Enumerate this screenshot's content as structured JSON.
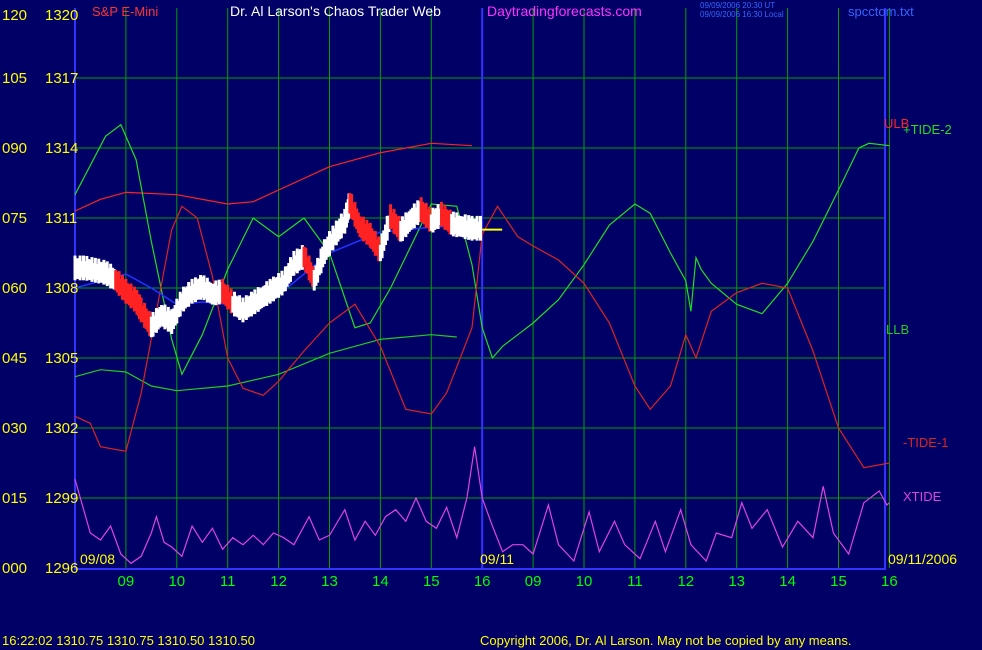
{
  "header": {
    "symbol_label": "S&P E-Mini",
    "title": "Dr. Al Larson's Chaos Trader Web",
    "site": "Daytradingforecasts.com",
    "stamp_line1": "09/09/2006 20:30 UT",
    "stamp_line2": "09/09/2006 16:30 Local",
    "file_name": "spcctom.txt"
  },
  "footer": {
    "quote": "16:22:02  1310.75 1310.75 1310.50 1310.50",
    "copyright": "Copyright 2006, Dr. Al Larson. May not be copied by any means."
  },
  "chart_data": {
    "type": "line",
    "y_labels_left": [
      "120",
      "105",
      "090",
      "075",
      "060",
      "045",
      "030",
      "015",
      "000"
    ],
    "y_labels_price": [
      "1320",
      "1317",
      "1314",
      "1311",
      "1308",
      "1305",
      "1302",
      "1299",
      "1296"
    ],
    "ylim_tide": [
      0,
      120
    ],
    "ylim_price": [
      1296,
      1320
    ],
    "x_ticks": [
      "09",
      "10",
      "11",
      "12",
      "13",
      "14",
      "15",
      "16",
      "09",
      "10",
      "11",
      "12",
      "13",
      "14",
      "15",
      "16"
    ],
    "date_labels": {
      "start": "09/08",
      "mid": "09/11",
      "end": "09/11/2006"
    },
    "grid": true,
    "series_labels": {
      "ulb": "ULB",
      "tide2": "+TIDE-2",
      "llb": "LLB",
      "tide1": "-TIDE-1",
      "xtide": "XTIDE"
    },
    "colors": {
      "background": "#000066",
      "grid": "#00a000",
      "axis": "#3333ff",
      "tick_text": "#00ff00",
      "left_text": "#ffff00",
      "ulb": "#ff2222",
      "tide2": "#22dd22",
      "llb": "#22cc22",
      "tide1": "#dd2222",
      "xtide": "#dd44dd",
      "price": "#ffffff",
      "price_down": "#ff2222",
      "avg": "#2233ff",
      "fast": "#ffff00"
    },
    "series": {
      "ulb": [
        [
          0,
          1311.3
        ],
        [
          0.5,
          1311.8
        ],
        [
          1,
          1312.1
        ],
        [
          2,
          1312.0
        ],
        [
          3,
          1311.6
        ],
        [
          3.5,
          1311.7
        ],
        [
          4,
          1312.2
        ],
        [
          5,
          1313.2
        ],
        [
          6,
          1313.8
        ],
        [
          7,
          1314.2
        ],
        [
          7.8,
          1314.1
        ]
      ],
      "llb": [
        [
          0,
          1304.2
        ],
        [
          0.5,
          1304.5
        ],
        [
          1,
          1304.4
        ],
        [
          1.5,
          1303.8
        ],
        [
          2,
          1303.6
        ],
        [
          3,
          1303.8
        ],
        [
          4,
          1304.3
        ],
        [
          5,
          1305.2
        ],
        [
          6,
          1305.8
        ],
        [
          7,
          1306.0
        ],
        [
          7.5,
          1305.9
        ]
      ],
      "tide2": [
        [
          0,
          1312.0
        ],
        [
          0.6,
          1314.5
        ],
        [
          0.9,
          1315.0
        ],
        [
          1.2,
          1313.5
        ],
        [
          1.5,
          1310.0
        ],
        [
          1.9,
          1305.8
        ],
        [
          2.1,
          1304.3
        ],
        [
          2.5,
          1306.0
        ],
        [
          3,
          1308.8
        ],
        [
          3.5,
          1311.0
        ],
        [
          4,
          1310.2
        ],
        [
          4.5,
          1311.0
        ],
        [
          5,
          1309.5
        ],
        [
          5.5,
          1306.3
        ],
        [
          5.8,
          1306.5
        ],
        [
          6.2,
          1308.0
        ],
        [
          7,
          1311.6
        ],
        [
          7.5,
          1311.5
        ],
        [
          7.8,
          1309.0
        ],
        [
          8,
          1306.3
        ],
        [
          8.2,
          1305.0
        ],
        [
          8.4,
          1305.5
        ],
        [
          8.7,
          1306.0
        ],
        [
          9,
          1306.5
        ],
        [
          9.5,
          1307.5
        ],
        [
          10,
          1309.0
        ],
        [
          10.5,
          1310.7
        ],
        [
          11,
          1311.6
        ],
        [
          11.3,
          1311.2
        ],
        [
          11.7,
          1309.5
        ],
        [
          12,
          1308.3
        ],
        [
          12.1,
          1307.0
        ],
        [
          12.2,
          1309.3
        ],
        [
          12.3,
          1308.8
        ],
        [
          12.5,
          1308.2
        ],
        [
          13,
          1307.3
        ],
        [
          13.5,
          1306.9
        ],
        [
          14,
          1308.2
        ],
        [
          14.5,
          1310.0
        ],
        [
          15,
          1312.2
        ],
        [
          15.4,
          1314.0
        ],
        [
          15.6,
          1314.2
        ],
        [
          16,
          1314.1
        ]
      ],
      "tide1": [
        [
          0,
          1302.5
        ],
        [
          0.3,
          1302.2
        ],
        [
          0.5,
          1301.2
        ],
        [
          1,
          1301.0
        ],
        [
          1.3,
          1303.5
        ],
        [
          1.6,
          1307.0
        ],
        [
          1.9,
          1310.5
        ],
        [
          2.1,
          1311.5
        ],
        [
          2.4,
          1311.0
        ],
        [
          2.7,
          1308.5
        ],
        [
          3,
          1305.0
        ],
        [
          3.3,
          1303.7
        ],
        [
          3.7,
          1303.4
        ],
        [
          4,
          1304.0
        ],
        [
          4.5,
          1305.3
        ],
        [
          5,
          1306.5
        ],
        [
          5.5,
          1307.3
        ],
        [
          6,
          1305.5
        ],
        [
          6.5,
          1302.8
        ],
        [
          7,
          1302.6
        ],
        [
          7.3,
          1303.5
        ],
        [
          7.8,
          1306.3
        ],
        [
          8,
          1310.3
        ],
        [
          8.3,
          1311.5
        ],
        [
          8.7,
          1310.2
        ],
        [
          9,
          1309.8
        ],
        [
          9.5,
          1309.2
        ],
        [
          10,
          1308.2
        ],
        [
          10.5,
          1306.5
        ],
        [
          11,
          1303.8
        ],
        [
          11.3,
          1302.8
        ],
        [
          11.7,
          1303.8
        ],
        [
          12,
          1306.0
        ],
        [
          12.2,
          1305.0
        ],
        [
          12.5,
          1307.0
        ],
        [
          13,
          1307.8
        ],
        [
          13.5,
          1308.2
        ],
        [
          14,
          1308.0
        ],
        [
          14.5,
          1305.3
        ],
        [
          15,
          1302.0
        ],
        [
          15.5,
          1300.3
        ],
        [
          16,
          1300.5
        ]
      ],
      "xtide": [
        [
          0,
          1299.8
        ],
        [
          0.3,
          1297.5
        ],
        [
          0.5,
          1297.2
        ],
        [
          0.7,
          1297.8
        ],
        [
          0.9,
          1296.6
        ],
        [
          1.1,
          1296.2
        ],
        [
          1.3,
          1296.5
        ],
        [
          1.5,
          1297.5
        ],
        [
          1.6,
          1298.2
        ],
        [
          1.75,
          1297.1
        ],
        [
          1.9,
          1296.9
        ],
        [
          2.1,
          1296.5
        ],
        [
          2.3,
          1297.8
        ],
        [
          2.5,
          1297.1
        ],
        [
          2.7,
          1297.7
        ],
        [
          2.9,
          1296.8
        ],
        [
          3.1,
          1297.3
        ],
        [
          3.3,
          1297.0
        ],
        [
          3.5,
          1297.4
        ],
        [
          3.7,
          1297.0
        ],
        [
          3.9,
          1297.5
        ],
        [
          4.1,
          1297.3
        ],
        [
          4.3,
          1297.0
        ],
        [
          4.6,
          1298.2
        ],
        [
          4.8,
          1297.2
        ],
        [
          5.0,
          1297.4
        ],
        [
          5.3,
          1298.5
        ],
        [
          5.5,
          1297.2
        ],
        [
          5.7,
          1298.0
        ],
        [
          5.9,
          1297.4
        ],
        [
          6.1,
          1298.2
        ],
        [
          6.3,
          1298.5
        ],
        [
          6.5,
          1298.0
        ],
        [
          6.7,
          1299.0
        ],
        [
          6.9,
          1298.0
        ],
        [
          7.1,
          1297.7
        ],
        [
          7.3,
          1298.6
        ],
        [
          7.5,
          1297.3
        ],
        [
          7.7,
          1299.0
        ],
        [
          7.85,
          1301.2
        ],
        [
          8.0,
          1299.0
        ],
        [
          8.2,
          1297.8
        ],
        [
          8.4,
          1296.7
        ],
        [
          8.6,
          1297.0
        ],
        [
          8.8,
          1297.0
        ],
        [
          9.0,
          1296.6
        ],
        [
          9.3,
          1298.7
        ],
        [
          9.5,
          1297.0
        ],
        [
          9.8,
          1296.3
        ],
        [
          10.1,
          1298.4
        ],
        [
          10.3,
          1296.7
        ],
        [
          10.6,
          1298.0
        ],
        [
          10.8,
          1297.0
        ],
        [
          11.1,
          1296.4
        ],
        [
          11.4,
          1298.0
        ],
        [
          11.6,
          1296.7
        ],
        [
          11.9,
          1298.5
        ],
        [
          12.1,
          1297.0
        ],
        [
          12.4,
          1296.3
        ],
        [
          12.6,
          1297.5
        ],
        [
          12.9,
          1297.3
        ],
        [
          13.1,
          1298.8
        ],
        [
          13.3,
          1297.7
        ],
        [
          13.6,
          1298.5
        ],
        [
          13.9,
          1296.9
        ],
        [
          14.2,
          1298.0
        ],
        [
          14.5,
          1297.3
        ],
        [
          14.7,
          1299.5
        ],
        [
          14.9,
          1297.5
        ],
        [
          15.2,
          1296.6
        ],
        [
          15.5,
          1298.8
        ],
        [
          15.8,
          1299.3
        ],
        [
          15.95,
          1298.7
        ],
        [
          16,
          1298.8
        ]
      ],
      "price": [
        [
          0,
          1308.8
        ],
        [
          0.2,
          1308.8
        ],
        [
          0.4,
          1308.7
        ],
        [
          0.6,
          1308.6
        ],
        [
          0.8,
          1308.3
        ],
        [
          1.0,
          1307.8
        ],
        [
          1.2,
          1307.4
        ],
        [
          1.3,
          1307.0
        ],
        [
          1.5,
          1306.3
        ],
        [
          1.7,
          1306.8
        ],
        [
          1.9,
          1306.5
        ],
        [
          2.1,
          1307.4
        ],
        [
          2.3,
          1307.8
        ],
        [
          2.5,
          1308.0
        ],
        [
          2.7,
          1307.7
        ],
        [
          2.9,
          1307.8
        ],
        [
          3.1,
          1307.3
        ],
        [
          3.3,
          1307.0
        ],
        [
          3.5,
          1307.3
        ],
        [
          3.7,
          1307.6
        ],
        [
          3.9,
          1307.9
        ],
        [
          4.1,
          1308.2
        ],
        [
          4.3,
          1309.0
        ],
        [
          4.5,
          1309.3
        ],
        [
          4.7,
          1308.3
        ],
        [
          4.9,
          1309.5
        ],
        [
          5.1,
          1310.2
        ],
        [
          5.3,
          1310.8
        ],
        [
          5.4,
          1311.6
        ],
        [
          5.6,
          1310.6
        ],
        [
          5.8,
          1310.2
        ],
        [
          6.0,
          1309.5
        ],
        [
          6.2,
          1311.0
        ],
        [
          6.4,
          1310.4
        ],
        [
          6.6,
          1310.9
        ],
        [
          6.8,
          1311.3
        ],
        [
          7.0,
          1310.8
        ],
        [
          7.2,
          1311.1
        ],
        [
          7.4,
          1310.7
        ],
        [
          7.6,
          1310.6
        ],
        [
          7.8,
          1310.5
        ],
        [
          8.0,
          1310.5
        ]
      ],
      "avg": [
        [
          0,
          1308.0
        ],
        [
          1,
          1308.6
        ],
        [
          1.5,
          1308.0
        ],
        [
          2,
          1307.3
        ],
        [
          2.5,
          1307.4
        ],
        [
          3,
          1307.3
        ],
        [
          3.5,
          1307.2
        ],
        [
          4,
          1307.7
        ],
        [
          5,
          1309.5
        ],
        [
          6,
          1310.4
        ],
        [
          7,
          1310.6
        ],
        [
          7.8,
          1310.7
        ]
      ]
    },
    "marker_hour": 8.0
  }
}
